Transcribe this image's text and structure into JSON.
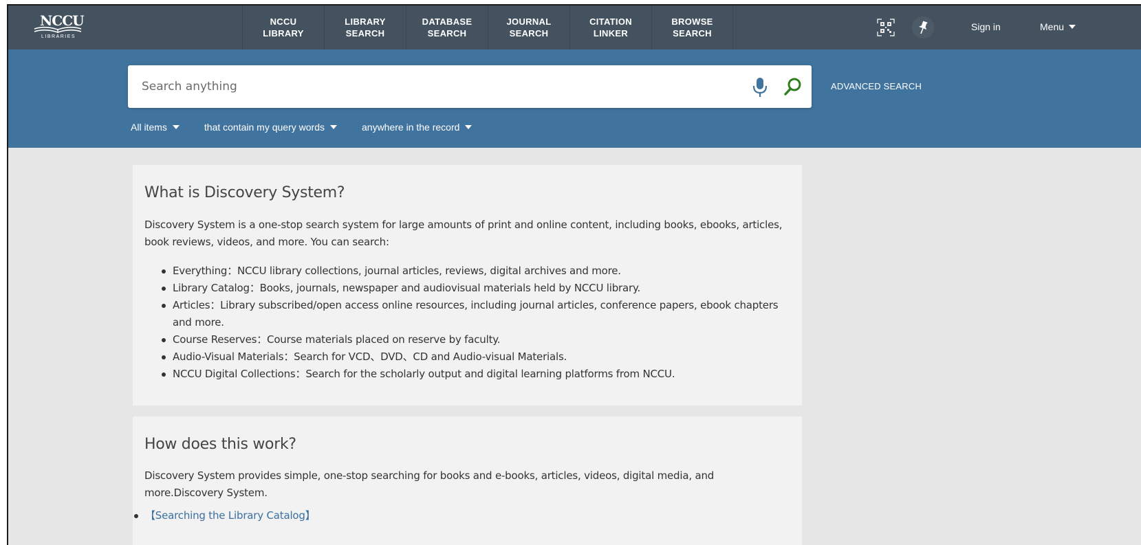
{
  "brand": {
    "logo_text": "NCCU",
    "logo_sub": "LIBRARIES"
  },
  "nav": {
    "links": [
      {
        "label": "NCCU\nLIBRARY"
      },
      {
        "label": "LIBRARY\nSEARCH"
      },
      {
        "label": "DATABASE\nSEARCH"
      },
      {
        "label": "JOURNAL\nSEARCH"
      },
      {
        "label": "CITATION\nLINKER"
      },
      {
        "label": "BROWSE\nSEARCH"
      }
    ],
    "sign_in": "Sign in",
    "menu": "Menu"
  },
  "search": {
    "placeholder": "Search anything",
    "advanced": "ADVANCED SEARCH",
    "filters": [
      {
        "label": "All items"
      },
      {
        "label": "that contain my query words"
      },
      {
        "label": "anywhere in the record"
      }
    ]
  },
  "about": {
    "title": "What is Discovery System?",
    "intro": "Discovery System is a one-stop search system for large amounts of print and online content, including books, ebooks, articles, book reviews, videos, and more. You can search:",
    "items": [
      "Everything：NCCU library collections, journal articles, reviews, digital archives and more.",
      "Library Catalog：Books, journals, newspaper and audiovisual materials held by NCCU library.",
      "Articles：Library subscribed/open access online resources, including journal articles, conference papers, ebook chapters and more.",
      "Course Reserves：Course materials placed on reserve by faculty.",
      "Audio-Visual Materials：Search for VCD、DVD、CD and Audio-visual Materials.",
      "NCCU Digital Collections：Search for the scholarly output and digital learning platforms from NCCU."
    ]
  },
  "how": {
    "title": "How does this work?",
    "intro": "Discovery System provides simple, one-stop searching for books and e-books, articles, videos, digital media, and more.Discovery System.",
    "links": [
      "【Searching the Library Catalog】"
    ]
  },
  "colors": {
    "topbar": "#44525f",
    "searchband": "#41739f",
    "search_icon": "#2e7d1f",
    "link": "#3a6fa0"
  },
  "icons": {
    "qr": "qr-code-icon",
    "pin": "pin-icon",
    "mic": "microphone-icon",
    "search": "search-icon"
  }
}
